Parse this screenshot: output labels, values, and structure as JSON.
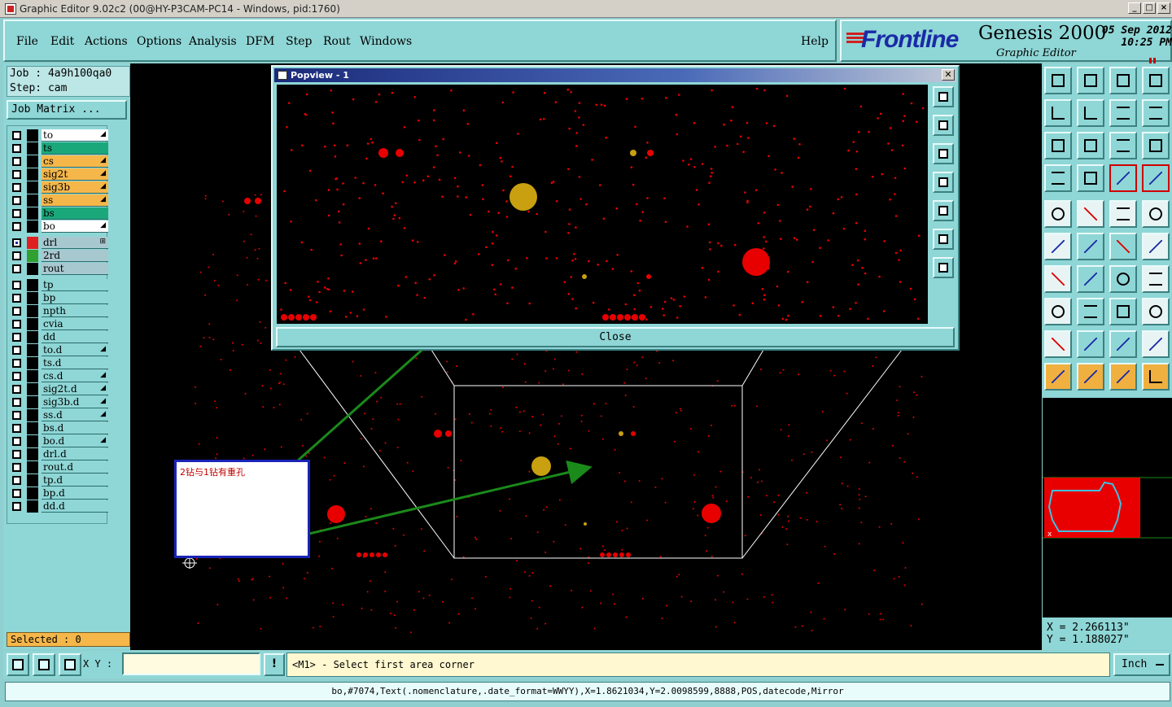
{
  "window": {
    "title": "Graphic Editor 9.02c2 (00@HY-P3CAM-PC14 - Windows, pid:1760)"
  },
  "menu": {
    "items": [
      "File",
      "Edit",
      "Actions",
      "Options",
      "Analysis",
      "DFM",
      "Step",
      "Rout",
      "Windows"
    ],
    "help": "Help"
  },
  "brand": {
    "company": "Frontline",
    "product": "Genesis 2000",
    "subtitle": "Graphic Editor",
    "date": "05 Sep 2012",
    "time": "10:25 PM"
  },
  "job": {
    "job_line": "Job : 4a9h100qa0",
    "step_line": "Step: cam",
    "matrix_button": "Job Matrix ..."
  },
  "layers": [
    {
      "name": "to",
      "bg": "#ffffff",
      "mark": "◢"
    },
    {
      "name": "ts",
      "bg": "#1aa87a",
      "mark": ""
    },
    {
      "name": "cs",
      "bg": "#f5b74a",
      "mark": "◢"
    },
    {
      "name": "sig2t",
      "bg": "#f5b74a",
      "mark": "◢"
    },
    {
      "name": "sig3b",
      "bg": "#f5b74a",
      "mark": "◢"
    },
    {
      "name": "ss",
      "bg": "#f5b74a",
      "mark": "◢"
    },
    {
      "name": "bs",
      "bg": "#1aa87a",
      "mark": ""
    },
    {
      "name": "bo",
      "bg": "#ffffff",
      "mark": "◢"
    },
    {
      "name": "drl",
      "bg": "#a8c8d0",
      "swatch": "#e02020",
      "mark": "⊞"
    },
    {
      "name": "2rd",
      "bg": "#a8c8d0",
      "swatch": "#30a030",
      "mark": ""
    },
    {
      "name": "rout",
      "bg": "#a8c8d0",
      "mark": ""
    },
    {
      "name": "tp",
      "bg": "#8fd6d6",
      "mark": ""
    },
    {
      "name": "bp",
      "bg": "#8fd6d6",
      "mark": ""
    },
    {
      "name": "npth",
      "bg": "#8fd6d6",
      "mark": ""
    },
    {
      "name": "cvia",
      "bg": "#8fd6d6",
      "mark": ""
    },
    {
      "name": "dd",
      "bg": "#8fd6d6",
      "mark": ""
    },
    {
      "name": "to.d",
      "bg": "#8fd6d6",
      "mark": "◢"
    },
    {
      "name": "ts.d",
      "bg": "#8fd6d6",
      "mark": ""
    },
    {
      "name": "cs.d",
      "bg": "#8fd6d6",
      "mark": "◢"
    },
    {
      "name": "sig2t.d",
      "bg": "#8fd6d6",
      "mark": "◢"
    },
    {
      "name": "sig3b.d",
      "bg": "#8fd6d6",
      "mark": "◢"
    },
    {
      "name": "ss.d",
      "bg": "#8fd6d6",
      "mark": "◢"
    },
    {
      "name": "bs.d",
      "bg": "#8fd6d6",
      "mark": ""
    },
    {
      "name": "bo.d",
      "bg": "#8fd6d6",
      "mark": "◢"
    },
    {
      "name": "drl.d",
      "bg": "#8fd6d6",
      "mark": ""
    },
    {
      "name": "rout.d",
      "bg": "#8fd6d6",
      "mark": ""
    },
    {
      "name": "tp.d",
      "bg": "#8fd6d6",
      "mark": ""
    },
    {
      "name": "bp.d",
      "bg": "#8fd6d6",
      "mark": ""
    },
    {
      "name": "dd.d",
      "bg": "#8fd6d6",
      "mark": ""
    }
  ],
  "selected_text": "Selected : 0",
  "popview": {
    "title": "Popview - 1",
    "close_label": "Close"
  },
  "annotation_text": "2钻与1钻有重孔",
  "coords": {
    "x_line": "X = 2.266113\"",
    "y_line": "Y = 1.188027\""
  },
  "bottom": {
    "xy_label": "X Y :",
    "xy_value": "",
    "excl": "!",
    "prompt": "<M1> - Select first area corner",
    "units": "Inch"
  },
  "status_line": "bo,#7074,Text(.nomenclature,.date_format=WWYY),X=1.8621034,Y=2.0098599,8888,POS,datecode,Mirror",
  "colors": {
    "panel": "#8fd6d6",
    "drill": "#e80000",
    "pad_gold": "#c8a010",
    "arrow": "#1a8a1a"
  }
}
